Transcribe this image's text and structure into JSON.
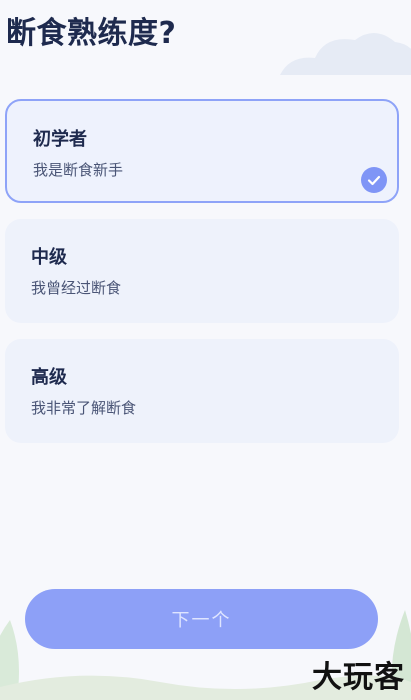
{
  "header": {
    "title": "断食熟练度?"
  },
  "options": [
    {
      "title": "初学者",
      "subtitle": "我是断食新手",
      "selected": true
    },
    {
      "title": "中级",
      "subtitle": "我曾经过断食",
      "selected": false
    },
    {
      "title": "高级",
      "subtitle": "我非常了解断食",
      "selected": false
    }
  ],
  "footer": {
    "next_label": "下一个"
  },
  "watermark": {
    "text": "大玩客"
  },
  "colors": {
    "accent": "#8da0f7",
    "selected_border": "#8ea3f8",
    "card_bg": "#eef2fb",
    "title_text": "#1e2a4e"
  }
}
